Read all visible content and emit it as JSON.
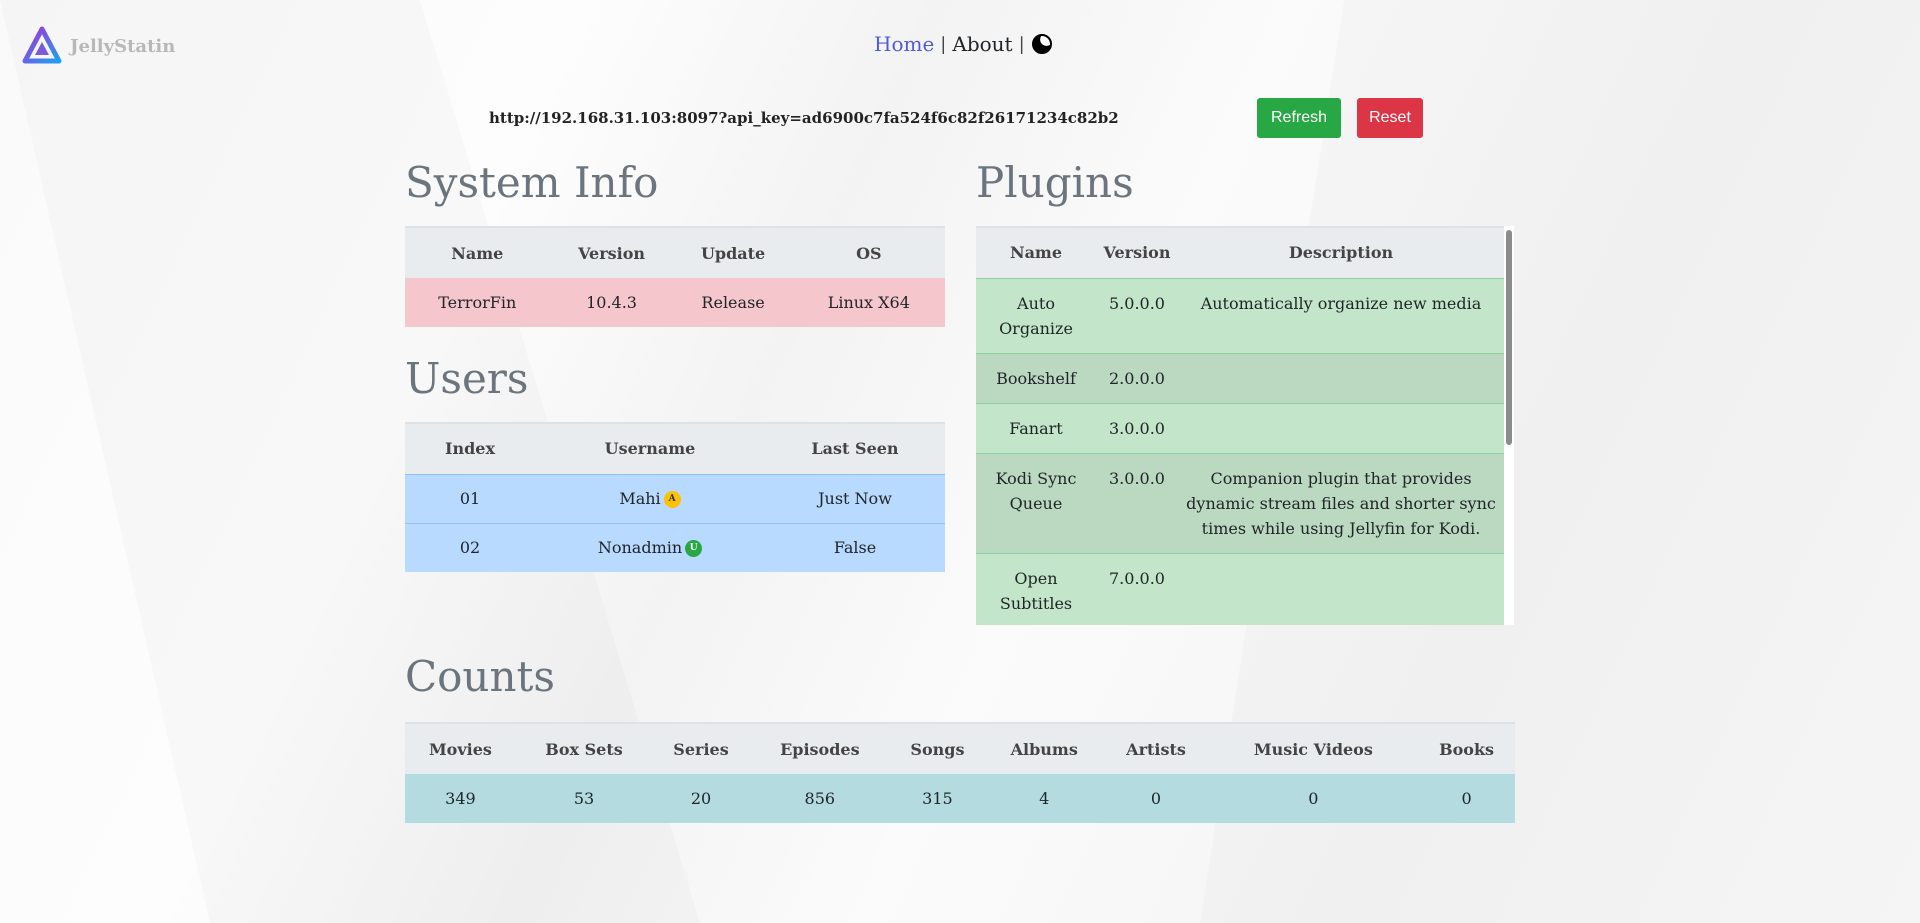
{
  "app": {
    "name": "JellyStatin"
  },
  "nav": {
    "home": "Home",
    "about": "About",
    "sep": "|",
    "theme_icon": "half-moon-icon"
  },
  "server": {
    "url": "http://192.168.31.103:8097?api_key=ad6900c7fa524f6c82f26171234c82b2",
    "refresh": "Refresh",
    "reset": "Reset"
  },
  "colors": {
    "refresh": "#28a745",
    "reset": "#dc3545",
    "link": "#4e5dd6"
  },
  "system": {
    "title": "System Info",
    "headers": [
      "Name",
      "Version",
      "Update",
      "OS"
    ],
    "row": [
      "TerrorFin",
      "10.4.3",
      "Release",
      "Linux X64"
    ]
  },
  "users": {
    "title": "Users",
    "headers": [
      "Index",
      "Username",
      "Last Seen"
    ],
    "rows": [
      {
        "index": "01",
        "username": "Mahi",
        "badge": "A",
        "last_seen": "Just Now"
      },
      {
        "index": "02",
        "username": "Nonadmin",
        "badge": "U",
        "last_seen": "False"
      }
    ]
  },
  "plugins": {
    "title": "Plugins",
    "headers": [
      "Name",
      "Version",
      "Description"
    ],
    "rows": [
      {
        "name": "Auto Organize",
        "version": "5.0.0.0",
        "description": "Automatically organize new media"
      },
      {
        "name": "Bookshelf",
        "version": "2.0.0.0",
        "description": ""
      },
      {
        "name": "Fanart",
        "version": "3.0.0.0",
        "description": ""
      },
      {
        "name": "Kodi Sync Queue",
        "version": "3.0.0.0",
        "description": "Companion plugin that provides dynamic stream files and shorter sync times while using Jellyfin for Kodi."
      },
      {
        "name": "Open Subtitles",
        "version": "7.0.0.0",
        "description": ""
      }
    ]
  },
  "counts": {
    "title": "Counts",
    "headers": [
      "Movies",
      "Box Sets",
      "Series",
      "Episodes",
      "Songs",
      "Albums",
      "Artists",
      "Music Videos",
      "Books"
    ],
    "values": [
      "349",
      "53",
      "20",
      "856",
      "315",
      "4",
      "0",
      "0",
      "0"
    ]
  }
}
